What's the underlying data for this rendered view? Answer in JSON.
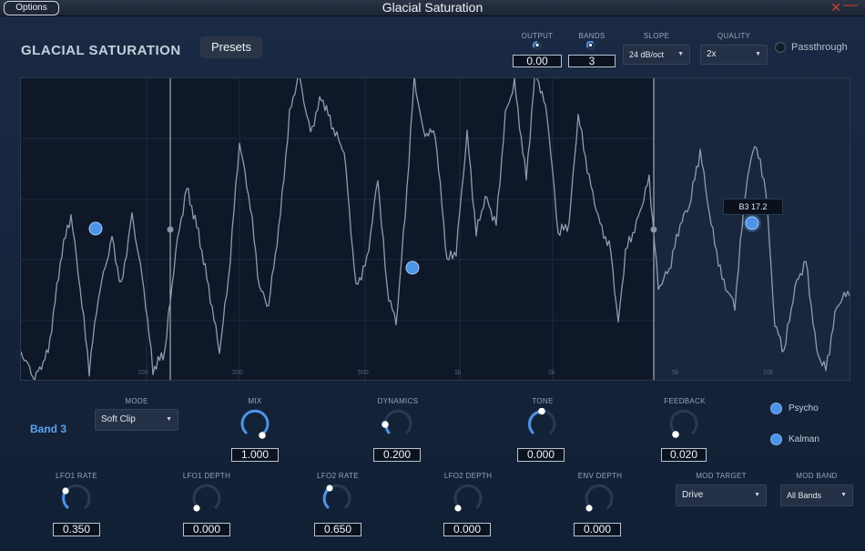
{
  "window": {
    "title": "Glacial Saturation",
    "options_label": "Options",
    "close_glyph": "✕",
    "minimize_glyph": "—"
  },
  "header": {
    "brand": "GLACIAL SATURATION",
    "presets_label": "Presets",
    "output_label": "OUTPUT",
    "output_value": "0.00",
    "bands_label": "BANDS",
    "bands_value": "3",
    "slope_label": "SLOPE",
    "slope_value": "24 dB/oct",
    "quality_label": "QUALITY",
    "quality_value": "2x",
    "passthrough_label": "Passthrough"
  },
  "graph": {
    "freq_labels": [
      "100",
      "200",
      "500",
      "1k",
      "2k",
      "5k",
      "10k"
    ],
    "tooltip": "B3 17.2"
  },
  "band_panel": {
    "band_name": "Band 3",
    "mode_label": "MODE",
    "mode_value": "Soft Clip",
    "mix_label": "MIX",
    "mix_value": "1.000",
    "dynamics_label": "DYNAMICS",
    "dynamics_value": "0.200",
    "tone_label": "TONE",
    "tone_value": "0.000",
    "feedback_label": "FEEDBACK",
    "feedback_value": "0.020",
    "psycho_label": "Psycho",
    "kalman_label": "Kalman"
  },
  "mod_panel": {
    "lfo1_rate_label": "LFO1 RATE",
    "lfo1_rate_value": "0.350",
    "lfo1_depth_label": "LFO1 DEPTH",
    "lfo1_depth_value": "0.000",
    "lfo2_rate_label": "LFO2 RATE",
    "lfo2_rate_value": "0.650",
    "lfo2_depth_label": "LFO2 DEPTH",
    "lfo2_depth_value": "0.000",
    "env_depth_label": "ENV DEPTH",
    "env_depth_value": "0.000",
    "mod_target_label": "MOD TARGET",
    "mod_target_value": "Drive",
    "mod_band_label": "MOD BAND",
    "mod_band_value": "All Bands"
  },
  "colors": {
    "accent": "#5aa3f0",
    "knob_arc": "#4d94e8",
    "background": "#16243a",
    "close": "#c8422e"
  }
}
